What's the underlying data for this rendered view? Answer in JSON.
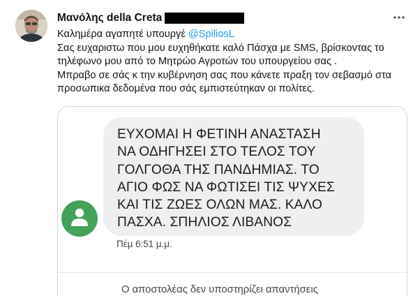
{
  "tweet": {
    "author_name": "Μανόλης della Creta",
    "more_icon": "more-horizontal-icon",
    "text": {
      "greeting_prefix": "Καλημέρα αγαπητέ υπουργέ ",
      "mention": "@SpiliosL",
      "lines": [
        "Σας ευχαριστω που μου ευχηθήκατε καλό Πάσχα  με SMS, βρίσκοντας το",
        "τηλέφωνο μου από το Μητρώο Αγροτών του υπουργείου σας .",
        "Μπραβο σε σάς κ την κυβέρνηση σας που κάνετε πραξη τον σεβασμό στα",
        "προσωπικα δεδομένα που σάς εμπιστεύτηκαν οι πολίτες."
      ]
    },
    "mention_color": "#1d9bf0"
  },
  "sms": {
    "message_lines": [
      "ΕΥΧΟΜΑΙ Η ΦΕΤΙΝΗ ΑΝΑΣΤΑΣΗ",
      "ΝΑ ΟΔΗΓΗΣΕΙ ΣΤΟ ΤΕΛΟΣ ΤΟΥ",
      "ΓΟΛΓΟΘΑ ΤΗΣ ΠΑΝΔΗΜΙΑΣ. ΤΟ",
      "ΑΓΙΟ ΦΩΣ ΝΑ ΦΩΤΙΣΕΙ ΤΙΣ ΨΥΧΕΣ",
      "ΚΑΙ ΤΙΣ ΖΩΕΣ ΟΛΩΝ ΜΑΣ. ΚΑΛΟ",
      "ΠΑΣΧΑ. ΣΠΗΛΙΟΣ ΛΙΒΑΝΟΣ"
    ],
    "timestamp": "Πέμ 6:51 μ.μ.",
    "footer": "Ο αποστολέας δεν υποστηρίζει απαντήσεις",
    "sender_icon": "person-icon",
    "avatar_color": "#43a15a",
    "bubble_color": "#edeff1"
  }
}
